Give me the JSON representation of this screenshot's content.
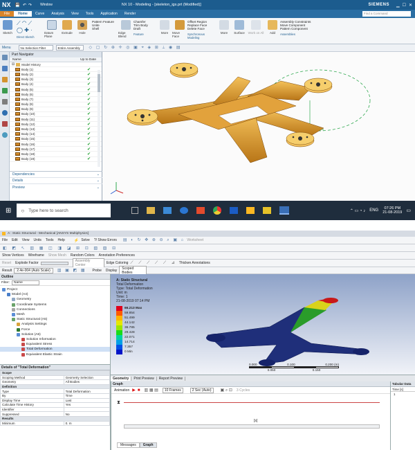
{
  "nx": {
    "logo": "NX",
    "window_label": "Window",
    "title": "NX 10 - Modeling - [skeleton_igs.prt (Modified)]",
    "brand": "SIEMENS",
    "search_placeholder": "Find a Command",
    "menu": [
      "File",
      "Home",
      "Curve",
      "Analysis",
      "View",
      "Tools",
      "Application",
      "Render"
    ],
    "ribbon": {
      "sketch": "Sketch",
      "direct_sketch": "Direct Sketch",
      "datum": "Datum Plane",
      "extrude": "Extrude",
      "hole": "Hole",
      "pattern_feature": "Pattern Feature",
      "unite": "Unite",
      "shell": "Shell",
      "edge_blend": "Edge Blend",
      "chamfer": "Chamfer",
      "trim_body": "Trim Body",
      "draft": "Draft",
      "more1": "More",
      "feature": "Feature",
      "move_face": "Move Face",
      "offset_region": "Offset Region",
      "replace_face": "Replace Face",
      "delete_face": "Delete Face",
      "more2": "More",
      "synchronous": "Synchronous Modeling",
      "surface": "Surface",
      "work_on_all": "Work on All",
      "add": "Add",
      "assembly_constraints": "Assembly Constraints",
      "move_component": "Move Component",
      "pattern_component": "Pattern Component",
      "assemblies": "Assemblies"
    },
    "selection": {
      "menu": "Menu",
      "filter": "No Selection Filter",
      "scope": "Entire Assembly"
    },
    "navigator": {
      "title": "Part Navigator",
      "col_name": "Name",
      "col_date": "Up to Date",
      "root": "Model History",
      "bodies": [
        "Body (1)",
        "Body (2)",
        "Body (3)",
        "Body (4)",
        "Body (5)",
        "Body (6)",
        "Body (7)",
        "Body (8)",
        "Body (9)",
        "Body (10)",
        "Body (11)",
        "Body (12)",
        "Body (13)",
        "Body (14)",
        "Body (15)",
        "Body (16)",
        "Body (17)",
        "Body (18)",
        "Body (19)"
      ],
      "check": "✔",
      "panels": [
        "Dependencies",
        "Details",
        "Preview"
      ]
    },
    "taskbar": {
      "search_placeholder": "Type here to search",
      "lang": "ENG",
      "time": "07:26 PM",
      "date": "21-08-2019"
    },
    "model_color": "#e8a23a"
  },
  "ansys": {
    "title": "A : Static Structural - Mechanical [ANSYS Multiphysics]",
    "menu": [
      "File",
      "Edit",
      "View",
      "Units",
      "Tools",
      "Help"
    ],
    "tb1": [
      "Solve",
      "?/ Show Errors",
      "Worksheet"
    ],
    "tb2": [
      "Show Vertices",
      "Wireframe",
      "Show Mesh",
      "Random Colors",
      "Annotation Preferences"
    ],
    "tb3": [
      "Reset",
      "Explode Factor",
      "Assembly Center",
      "Edge Coloring",
      "Thicken Annotations"
    ],
    "tb4": [
      "Result",
      "2.4e-004 (Auto Scale)",
      "Probe",
      "Display",
      "Scoped Bodies"
    ],
    "outline": {
      "title": "Outline",
      "filter_label": "Filter:",
      "filter_value": "Name",
      "items": [
        {
          "label": "Project",
          "level": 0
        },
        {
          "label": "Model (A4)",
          "level": 1
        },
        {
          "label": "Geometry",
          "level": 2
        },
        {
          "label": "Coordinate Systems",
          "level": 2
        },
        {
          "label": "Connections",
          "level": 2
        },
        {
          "label": "Mesh",
          "level": 2
        },
        {
          "label": "Static Structural (A5)",
          "level": 2
        },
        {
          "label": "Analysis Settings",
          "level": 3
        },
        {
          "label": "Force",
          "level": 3
        },
        {
          "label": "Solution (A6)",
          "level": 3
        },
        {
          "label": "Solution Information",
          "level": 4
        },
        {
          "label": "Equivalent Stress",
          "level": 4
        },
        {
          "label": "Total Deformation",
          "level": 4
        },
        {
          "label": "Equivalent Elastic Strain",
          "level": 4
        }
      ]
    },
    "details": {
      "title": "Details of \"Total Deformation\"",
      "rows": [
        {
          "k": "Scope",
          "v": "",
          "sec": true
        },
        {
          "k": "Scoping Method",
          "v": "Geometry Selection"
        },
        {
          "k": "Geometry",
          "v": "All Bodies"
        },
        {
          "k": "Definition",
          "v": "",
          "sec": true
        },
        {
          "k": "Type",
          "v": "Total Deformation"
        },
        {
          "k": "By",
          "v": "Time"
        },
        {
          "k": "Display Time",
          "v": "Last"
        },
        {
          "k": "Calculate Time History",
          "v": "Yes"
        },
        {
          "k": "Identifier",
          "v": ""
        },
        {
          "k": "Suppressed",
          "v": "No"
        },
        {
          "k": "Results",
          "v": "",
          "sec": true
        },
        {
          "k": "Minimum",
          "v": "0. m"
        }
      ]
    },
    "result": {
      "heading": "A: Static Structural",
      "name": "Total Deformation",
      "type": "Type: Total Deformation",
      "unit": "Unit: m",
      "time": "Time: 1",
      "date": "21-08-2019 07:14 PM",
      "legend": [
        {
          "label": "66.213 Max",
          "color": "#e0001b"
        },
        {
          "label": "59.854",
          "color": "#ff5a00"
        },
        {
          "label": "51.499",
          "color": "#ffb400"
        },
        {
          "label": "44.142",
          "color": "#e6e600"
        },
        {
          "label": "36.785",
          "color": "#9be600"
        },
        {
          "label": "29.428",
          "color": "#19dc19"
        },
        {
          "label": "22.071",
          "color": "#00d2a0"
        },
        {
          "label": "14.714",
          "color": "#00a0e6"
        },
        {
          "label": "7.357",
          "color": "#0050e6"
        },
        {
          "label": "0 Min",
          "color": "#0014c8"
        }
      ],
      "scale": {
        "l0": "0.000",
        "l1": "0.100",
        "l2": "0.200 (m)",
        "m1": "0.050",
        "m2": "0.150"
      }
    },
    "view_tabs": [
      "Geometry",
      "Print Preview",
      "Report Preview"
    ],
    "graph": {
      "title": "Graph",
      "animation_label": "Animation",
      "frames": "10 Frames",
      "duration": "2 Sec (Auto)",
      "cycles": "3 Cycles",
      "axis_label": "[s]",
      "bottom_tabs": [
        "Messages",
        "Graph"
      ]
    },
    "tabular": {
      "title": "Tabular Data",
      "col_time": "Time [s]",
      "row1": "1"
    }
  }
}
